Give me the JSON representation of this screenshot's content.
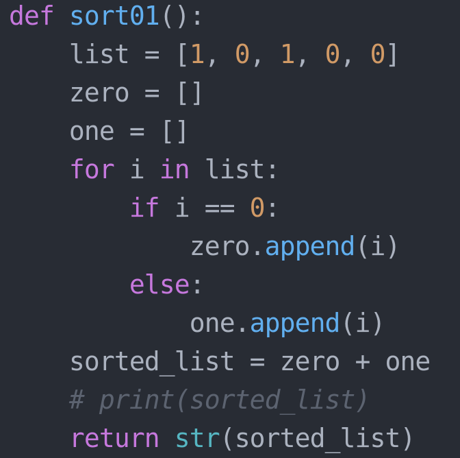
{
  "colors": {
    "background": "#282c34",
    "keyword": "#c678dd",
    "function": "#61afef",
    "builtin": "#56b6c2",
    "number": "#d19a66",
    "text": "#abb2bf",
    "comment": "#5c6370"
  },
  "code": {
    "lines": [
      [
        {
          "t": "def",
          "k": "kw"
        },
        {
          "t": " ",
          "k": "plain"
        },
        {
          "t": "sort01",
          "k": "fn"
        },
        {
          "t": "():",
          "k": "plain"
        }
      ],
      [
        {
          "t": "    list = [",
          "k": "plain"
        },
        {
          "t": "1",
          "k": "num"
        },
        {
          "t": ", ",
          "k": "plain"
        },
        {
          "t": "0",
          "k": "num"
        },
        {
          "t": ", ",
          "k": "plain"
        },
        {
          "t": "1",
          "k": "num"
        },
        {
          "t": ", ",
          "k": "plain"
        },
        {
          "t": "0",
          "k": "num"
        },
        {
          "t": ", ",
          "k": "plain"
        },
        {
          "t": "0",
          "k": "num"
        },
        {
          "t": "]",
          "k": "plain"
        }
      ],
      [
        {
          "t": "    zero = []",
          "k": "plain"
        }
      ],
      [
        {
          "t": "    one = []",
          "k": "plain"
        }
      ],
      [
        {
          "t": "    ",
          "k": "plain"
        },
        {
          "t": "for",
          "k": "kw"
        },
        {
          "t": " i ",
          "k": "plain"
        },
        {
          "t": "in",
          "k": "kw"
        },
        {
          "t": " list:",
          "k": "plain"
        }
      ],
      [
        {
          "t": "        ",
          "k": "plain"
        },
        {
          "t": "if",
          "k": "kw"
        },
        {
          "t": " i == ",
          "k": "plain"
        },
        {
          "t": "0",
          "k": "num"
        },
        {
          "t": ":",
          "k": "plain"
        }
      ],
      [
        {
          "t": "            zero.",
          "k": "plain"
        },
        {
          "t": "append",
          "k": "fn"
        },
        {
          "t": "(i)",
          "k": "plain"
        }
      ],
      [
        {
          "t": "        ",
          "k": "plain"
        },
        {
          "t": "else",
          "k": "kw"
        },
        {
          "t": ":",
          "k": "plain"
        }
      ],
      [
        {
          "t": "            one.",
          "k": "plain"
        },
        {
          "t": "append",
          "k": "fn"
        },
        {
          "t": "(i)",
          "k": "plain"
        }
      ],
      [
        {
          "t": "    sorted_list = zero + one",
          "k": "plain"
        }
      ],
      [
        {
          "t": "    ",
          "k": "plain"
        },
        {
          "t": "# print(sorted_list)",
          "k": "cmt"
        }
      ],
      [
        {
          "t": "    ",
          "k": "plain"
        },
        {
          "t": "return",
          "k": "kw"
        },
        {
          "t": " ",
          "k": "plain"
        },
        {
          "t": "str",
          "k": "bi"
        },
        {
          "t": "(sorted_list)",
          "k": "plain"
        }
      ]
    ]
  }
}
